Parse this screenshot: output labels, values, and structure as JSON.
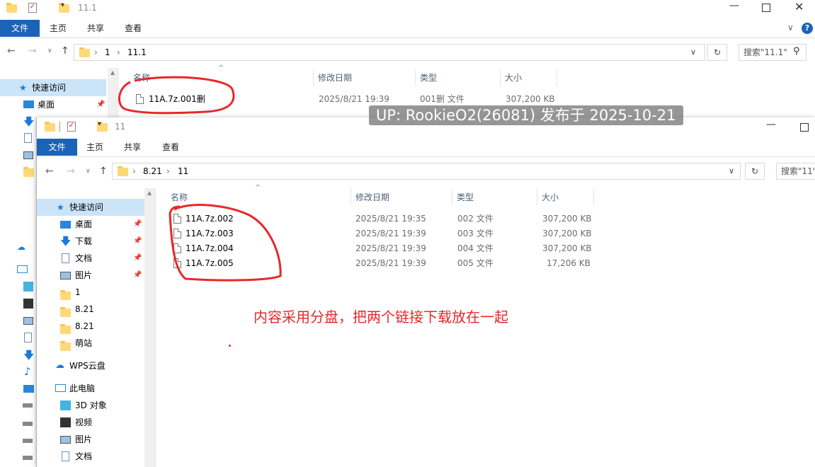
{
  "back_window": {
    "title": "11.1",
    "ribbon": {
      "file": "文件",
      "home": "主页",
      "share": "共享",
      "view": "查看"
    },
    "breadcrumb": [
      "1",
      "11.1"
    ],
    "search_placeholder": "搜索\"11.1\"",
    "columns": {
      "name": "名称",
      "date": "修改日期",
      "type": "类型",
      "size": "大小"
    },
    "files": [
      {
        "name": "11A.7z.001删",
        "date": "2025/8/21 19:39",
        "type": "001删 文件",
        "size": "307,200 KB"
      }
    ],
    "sidebar": {
      "quick_access": "快速访问",
      "desktop": "桌面"
    }
  },
  "front_window": {
    "title": "11",
    "ribbon": {
      "file": "文件",
      "home": "主页",
      "share": "共享",
      "view": "查看"
    },
    "breadcrumb": [
      "8.21",
      "11"
    ],
    "search_placeholder": "搜索\"11\"",
    "columns": {
      "name": "名称",
      "date": "修改日期",
      "type": "类型",
      "size": "大小"
    },
    "files": [
      {
        "name": "11A.7z.002",
        "date": "2025/8/21 19:35",
        "type": "002 文件",
        "size": "307,200 KB"
      },
      {
        "name": "11A.7z.003",
        "date": "2025/8/21 19:39",
        "type": "003 文件",
        "size": "307,200 KB"
      },
      {
        "name": "11A.7z.004",
        "date": "2025/8/21 19:39",
        "type": "004 文件",
        "size": "307,200 KB"
      },
      {
        "name": "11A.7z.005",
        "date": "2025/8/21 19:39",
        "type": "005 文件",
        "size": "17,206 KB"
      }
    ],
    "sidebar": {
      "quick_access": "快速访问",
      "items": [
        {
          "label": "桌面",
          "icon": "desktop-icon",
          "pinned": true
        },
        {
          "label": "下载",
          "icon": "download-icon",
          "pinned": true
        },
        {
          "label": "文档",
          "icon": "document-icon",
          "pinned": true
        },
        {
          "label": "图片",
          "icon": "picture-icon",
          "pinned": true
        },
        {
          "label": "1",
          "icon": "folder-icon",
          "pinned": false
        },
        {
          "label": "8.21",
          "icon": "folder-icon",
          "pinned": false
        },
        {
          "label": "8.21",
          "icon": "folder-icon",
          "pinned": false
        },
        {
          "label": "萌站",
          "icon": "folder-icon",
          "pinned": false
        }
      ],
      "wps": "WPS云盘",
      "this_pc": "此电脑",
      "pc_items": [
        {
          "label": "3D 对象",
          "icon": "3d-objects-icon"
        },
        {
          "label": "视频",
          "icon": "video-icon"
        },
        {
          "label": "图片",
          "icon": "picture-icon"
        },
        {
          "label": "文档",
          "icon": "document-icon"
        }
      ]
    }
  },
  "watermark": "UP: RookieO2(26081) 发布于 2025-10-21",
  "annotation": "内容采用分盘，把两个链接下载放在一起",
  "colors": {
    "file_tab": "#1b63b7",
    "annotation_red": "#e8282a",
    "folder": "#ffd977"
  }
}
